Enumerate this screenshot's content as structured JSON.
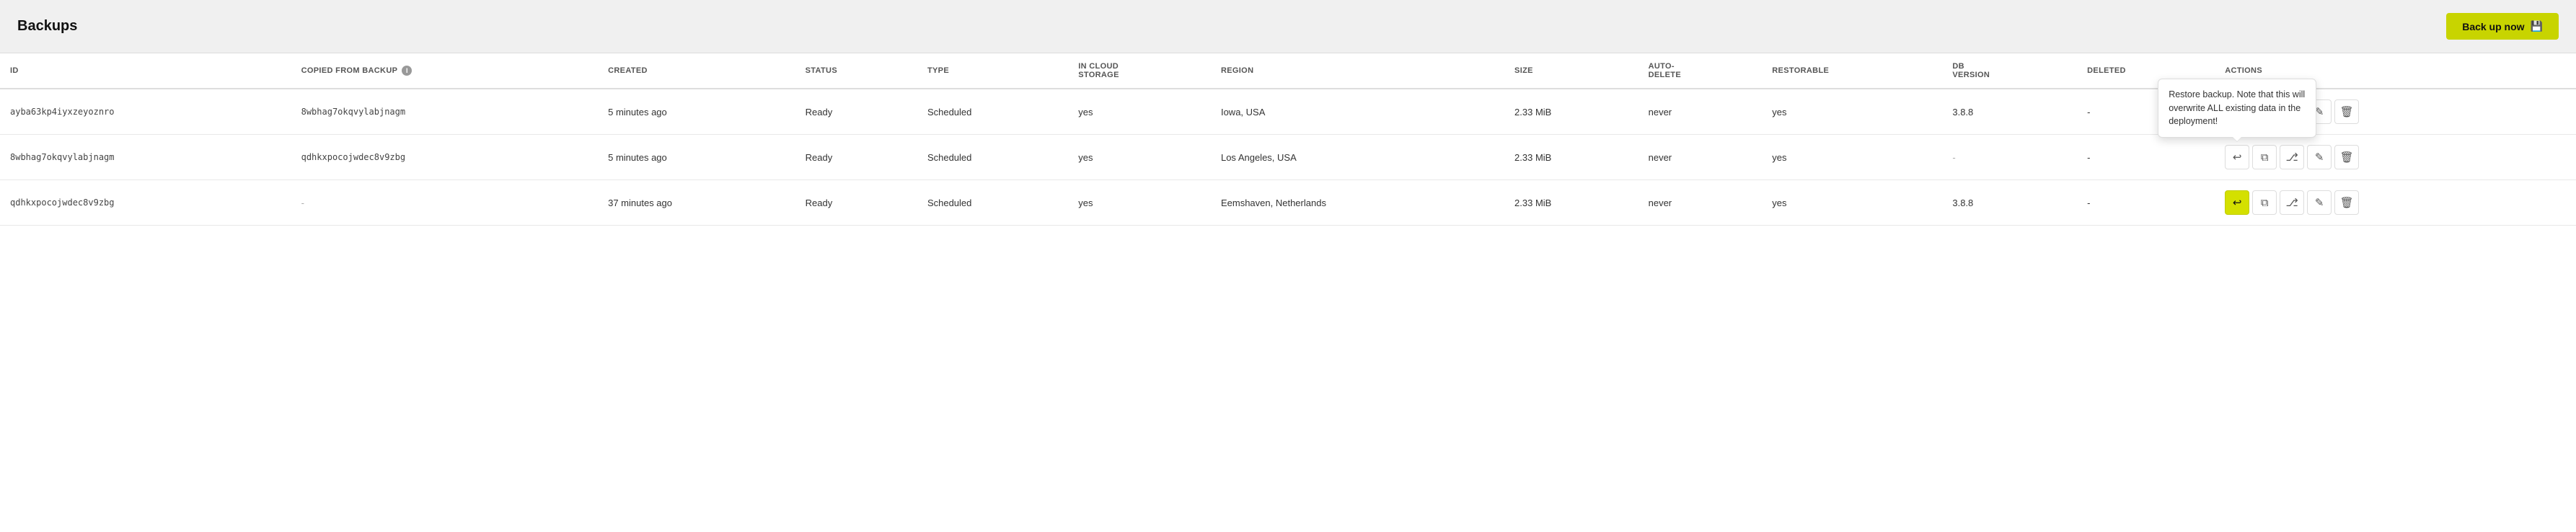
{
  "header": {
    "title": "Backups",
    "backup_btn_label": "Back up now",
    "backup_btn_icon": "💾"
  },
  "columns": [
    {
      "key": "id",
      "label": "ID"
    },
    {
      "key": "copied_from",
      "label": "COPIED FROM BACKUP",
      "has_info": true
    },
    {
      "key": "created",
      "label": "CREATED"
    },
    {
      "key": "status",
      "label": "STATUS"
    },
    {
      "key": "type",
      "label": "TYPE"
    },
    {
      "key": "in_cloud_storage",
      "label": "IN CLOUD STORAGE"
    },
    {
      "key": "region",
      "label": "REGION"
    },
    {
      "key": "size",
      "label": "SIZE"
    },
    {
      "key": "auto_delete",
      "label": "AUTO-DELETE"
    },
    {
      "key": "restorable",
      "label": "RESTORABLE"
    },
    {
      "key": "db_version",
      "label": "DB VERSION"
    },
    {
      "key": "deleted",
      "label": "DELETED"
    },
    {
      "key": "actions",
      "label": "ACTIONS"
    }
  ],
  "rows": [
    {
      "id": "ayba63kp4iyxzeyoznro",
      "copied_from": "8wbhag7okqvylabjnagm",
      "created": "5 minutes ago",
      "status": "Ready",
      "type": "Scheduled",
      "in_cloud_storage": "yes",
      "region": "Iowa, USA",
      "size": "2.33 MiB",
      "auto_delete": "never",
      "restorable": "yes",
      "db_version": "3.8.8",
      "deleted": "-"
    },
    {
      "id": "8wbhag7okqvylabjnagm",
      "copied_from": "qdhkxpocojwdec8v9zbg",
      "created": "5 minutes ago",
      "status": "Ready",
      "type": "Scheduled",
      "in_cloud_storage": "yes",
      "region": "Los Angeles, USA",
      "size": "2.33 MiB",
      "auto_delete": "never",
      "restorable": "yes",
      "db_version": "",
      "deleted": "-"
    },
    {
      "id": "qdhkxpocojwdec8v9zbg",
      "copied_from": "-",
      "created": "37 minutes ago",
      "status": "Ready",
      "type": "Scheduled",
      "in_cloud_storage": "yes",
      "region": "Eemshaven, Netherlands",
      "size": "2.33 MiB",
      "auto_delete": "never",
      "restorable": "yes",
      "db_version": "3.8.8",
      "deleted": "-"
    }
  ],
  "tooltip": {
    "text": "Restore backup. Note that this will overwrite ALL existing data in the deployment!"
  },
  "icons": {
    "restore": "↩",
    "copy": "⧉",
    "branch": "⎇",
    "edit": "✎",
    "delete": "🗑"
  }
}
